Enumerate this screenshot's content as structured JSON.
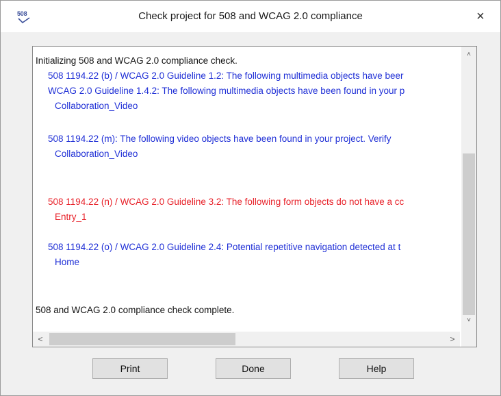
{
  "window": {
    "icon_text": "508",
    "title": "Check project for 508 and WCAG 2.0 compliance",
    "close_symbol": "×"
  },
  "log": {
    "lines": [
      {
        "text": "Initializing 508 and WCAG 2.0 compliance check.",
        "color": "black"
      },
      {
        "text": "508 1194.22 (b) / WCAG 2.0 Guideline 1.2: The following multimedia objects have beer",
        "color": "blue"
      },
      {
        "text": "WCAG 2.0 Guideline 1.4.2: The following multimedia objects have been found in your p",
        "color": "blue"
      },
      {
        "text": "Collaboration_Video",
        "color": "blue"
      },
      {
        "text": "508 1194.22 (m): The following video objects have been found in your project.  Verify",
        "color": "blue"
      },
      {
        "text": "Collaboration_Video",
        "color": "blue"
      },
      {
        "text": "508 1194.22 (n) / WCAG 2.0 Guideline 3.2: The following form objects do not have a cc",
        "color": "red"
      },
      {
        "text": "Entry_1",
        "color": "red"
      },
      {
        "text": "508 1194.22 (o) / WCAG 2.0 Guideline 2.4: Potential repetitive navigation detected at t",
        "color": "blue"
      },
      {
        "text": "Home",
        "color": "blue"
      },
      {
        "text": "508 and WCAG 2.0 compliance check complete.",
        "color": "black"
      }
    ]
  },
  "scrollbars": {
    "up": "˄",
    "down": "˅",
    "left": "<",
    "right": ">"
  },
  "buttons": {
    "print": "Print",
    "done": "Done",
    "help": "Help"
  },
  "colors": {
    "info_text": "#1f2fd6",
    "error_text": "#e8222a",
    "button_face": "#e1e1e1"
  }
}
